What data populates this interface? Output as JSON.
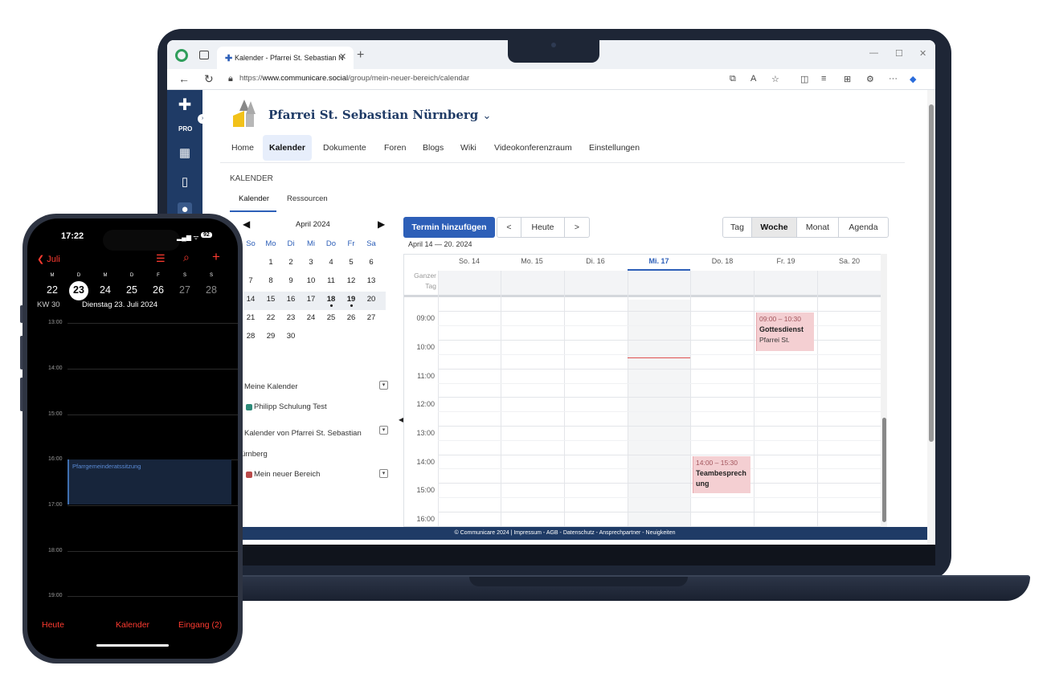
{
  "browser": {
    "tab_title": "Kalender - Pfarrei St. Sebastian N",
    "url_prefix": "https://",
    "url_host": "www.communicare.social",
    "url_path": "/group/mein-neuer-bereich/calendar"
  },
  "app": {
    "sidebar_badge": "PRO",
    "group_name": "Pfarrei St. Sebastian Nürnberg",
    "nav": [
      "Home",
      "Kalender",
      "Dokumente",
      "Foren",
      "Blogs",
      "Wiki",
      "Videokonferenzraum",
      "Einstellungen"
    ],
    "active_nav": "Kalender",
    "section_title": "KALENDER",
    "subtabs": [
      "Kalender",
      "Ressourcen"
    ],
    "footer": "© Communicare 2024 | Impressum - AGB - Datenschutz - Ansprechpartner - Neuigkeiten"
  },
  "mini_calendar": {
    "month": "April 2024",
    "weekdays": [
      "So",
      "Mo",
      "Di",
      "Mi",
      "Do",
      "Fr",
      "Sa"
    ],
    "weeks": [
      [
        "",
        "1",
        "2",
        "3",
        "4",
        "5",
        "6"
      ],
      [
        "7",
        "8",
        "9",
        "10",
        "11",
        "12",
        "13"
      ],
      [
        "14",
        "15",
        "16",
        "17",
        "18",
        "19",
        "20"
      ],
      [
        "21",
        "22",
        "23",
        "24",
        "25",
        "26",
        "27"
      ],
      [
        "28",
        "29",
        "30",
        "",
        "",
        "",
        ""
      ]
    ]
  },
  "calendars": {
    "my_label": "Meine Kalender",
    "my_item": "Philipp Schulung Test",
    "my_item_color": "#2e8b7a",
    "group_label_1": "Kalender von Pfarrei St. Sebastian",
    "group_label_2": "ürnberg",
    "group_item": "Mein neuer Bereich",
    "group_item_color": "#b94a4a"
  },
  "toolbar": {
    "add": "Termin hinzufügen",
    "prev": "<",
    "today": "Heute",
    "next": ">",
    "views": [
      "Tag",
      "Woche",
      "Monat",
      "Agenda"
    ],
    "active_view": "Woche",
    "range": "April 14 — 20. 2024"
  },
  "week": {
    "days": [
      "So. 14",
      "Mo. 15",
      "Di. 16",
      "Mi. 17",
      "Do. 18",
      "Fr. 19",
      "Sa. 20"
    ],
    "today": "Mi. 17",
    "allday_label": [
      "Ganzer",
      "Tag"
    ],
    "hours": [
      "09:00",
      "10:00",
      "11:00",
      "12:00",
      "13:00",
      "14:00",
      "15:00",
      "16:00"
    ],
    "events": [
      {
        "time": "09:00 – 10:30",
        "title": "Gottesdienst",
        "sub": "Pfarrei St."
      },
      {
        "time": "14:00 – 15:30",
        "title": "Teambesprech ung",
        "sub": ""
      }
    ]
  },
  "phone": {
    "clock": "17:22",
    "battery": "92",
    "back": "Juli",
    "weekday_letters": [
      "M",
      "D",
      "M",
      "D",
      "F",
      "S",
      "S"
    ],
    "dates": [
      "22",
      "23",
      "24",
      "25",
      "26",
      "27",
      "28"
    ],
    "week_no": "KW 30",
    "day_label": "Dienstag  23. Juli 2024",
    "hours": [
      "13:00",
      "14:00",
      "15:00",
      "16:00",
      "17:00",
      "18:00",
      "19:00"
    ],
    "event": "Pfarrgemeinderatssitzung",
    "tabs": [
      "Heute",
      "Kalender",
      "Eingang (2)"
    ]
  }
}
